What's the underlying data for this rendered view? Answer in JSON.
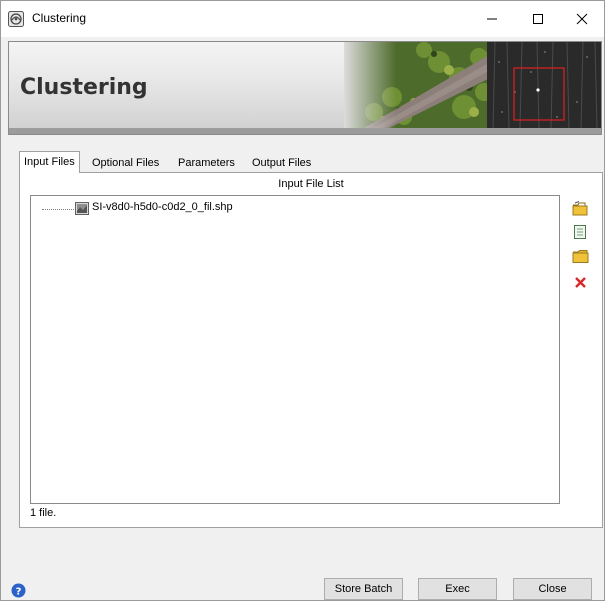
{
  "window": {
    "title": "Clustering",
    "controls": [
      "minimize-icon",
      "maximize-icon",
      "close-icon"
    ]
  },
  "banner": {
    "title": "Clustering"
  },
  "tabs": [
    {
      "label": "Input Files",
      "active": true
    },
    {
      "label": "Optional Files",
      "active": false
    },
    {
      "label": "Parameters",
      "active": false
    },
    {
      "label": "Output Files",
      "active": false
    }
  ],
  "input_panel": {
    "list_title": "Input File List",
    "files": [
      {
        "name": "SI-v8d0-h5d0-c0d2_0_fil.shp",
        "icon": "shapefile-icon"
      }
    ],
    "status": "1 file.",
    "side_buttons": [
      "open-folder-icon",
      "new-file-icon",
      "folder-icon",
      "delete-icon"
    ]
  },
  "footer": {
    "help_icon": "help-icon",
    "store_batch_label": "Store Batch",
    "exec_label": "Exec",
    "close_label": "Close"
  },
  "colors": {
    "banner_text": "#333333",
    "delete_red": "#d42a2a",
    "folder_yellow": "#f0c23a",
    "help_blue": "#2a62c9"
  }
}
